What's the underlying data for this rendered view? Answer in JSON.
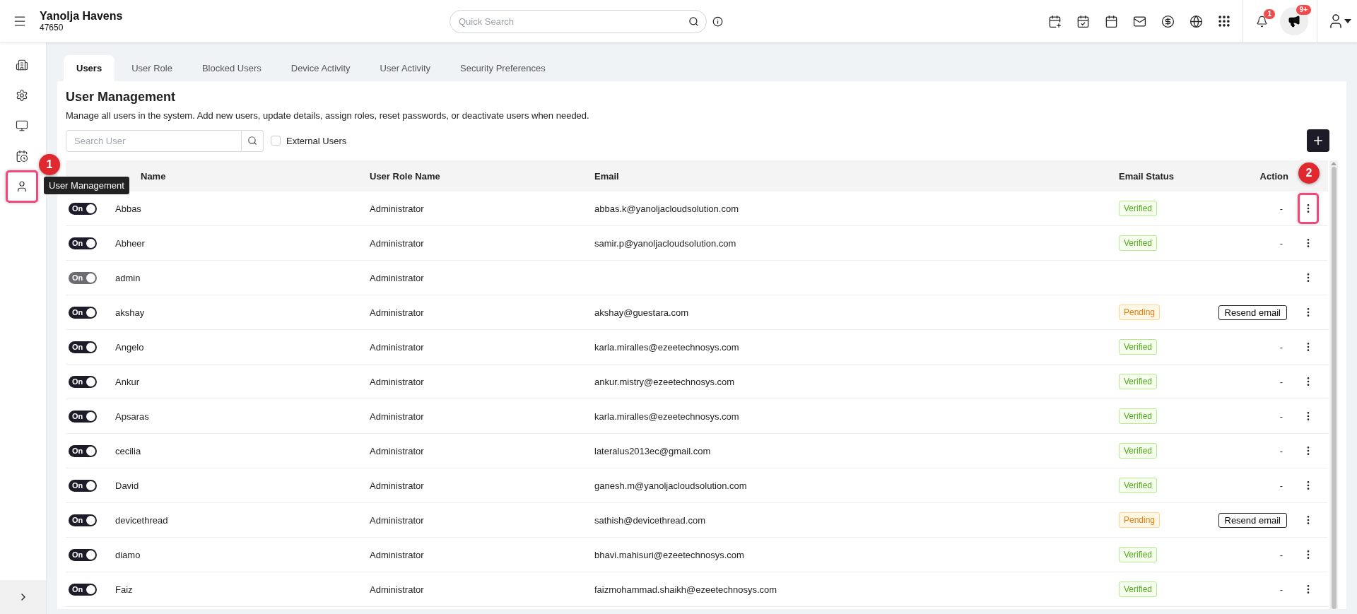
{
  "top_bar": {
    "property_name": "Yanolja Havens",
    "property_id": "47650",
    "search": {
      "placeholder": "Quick Search"
    },
    "notifications": {
      "badge": "1"
    },
    "announcements": {
      "badge": "9+"
    }
  },
  "sidebar": {
    "items": [
      {
        "kind": "building",
        "highlighted": false
      },
      {
        "kind": "settings",
        "highlighted": false
      },
      {
        "kind": "monitor",
        "highlighted": false
      },
      {
        "kind": "calendar",
        "highlighted": false
      },
      {
        "kind": "user",
        "highlighted": true,
        "marker": "1",
        "tooltip": "User Management"
      }
    ]
  },
  "tabs": [
    {
      "label": "Users",
      "selected": true
    },
    {
      "label": "User Role",
      "selected": false
    },
    {
      "label": "Blocked Users",
      "selected": false
    },
    {
      "label": "Device Activity",
      "selected": false
    },
    {
      "label": "User Activity",
      "selected": false
    },
    {
      "label": "Security Preferences",
      "selected": false
    }
  ],
  "panel": {
    "title": "User Management",
    "description": "Manage all users in the system. Add new users, update details, assign roles, reset passwords, or deactivate users when needed.",
    "search": {
      "placeholder": "Search User"
    },
    "external_users": {
      "label": "External Users",
      "checked": false
    }
  },
  "table": {
    "columns": [
      "Name",
      "User Role Name",
      "Email",
      "Email Status",
      "Action"
    ],
    "rows": [
      {
        "toggle": {
          "label": "On",
          "on": true,
          "disabled": false
        },
        "name": "Abbas",
        "role": "Administrator",
        "email": "abbas.k@yanoljacloudsolution.com",
        "status": {
          "label": "Verified",
          "kind": "verified"
        },
        "action": {
          "kind": "dash",
          "label": "-"
        },
        "menu_highlighted": true,
        "marker": "2"
      },
      {
        "toggle": {
          "label": "On",
          "on": true,
          "disabled": false
        },
        "name": "Abheer",
        "role": "Administrator",
        "email": "samir.p@yanoljacloudsolution.com",
        "status": {
          "label": "Verified",
          "kind": "verified"
        },
        "action": {
          "kind": "dash",
          "label": "-"
        },
        "menu_highlighted": false
      },
      {
        "toggle": {
          "label": "On",
          "on": true,
          "disabled": true
        },
        "name": "admin",
        "role": "Administrator",
        "menu_highlighted": false
      },
      {
        "toggle": {
          "label": "On",
          "on": true,
          "disabled": false
        },
        "name": "akshay",
        "role": "Administrator",
        "email": "akshay@guestara.com",
        "status": {
          "label": "Pending",
          "kind": "pending"
        },
        "action": {
          "kind": "button",
          "label": "Resend email"
        },
        "menu_highlighted": false
      },
      {
        "toggle": {
          "label": "On",
          "on": true,
          "disabled": false
        },
        "name": "Angelo",
        "role": "Administrator",
        "email": "karla.miralles@ezeetechnosys.com",
        "status": {
          "label": "Verified",
          "kind": "verified"
        },
        "action": {
          "kind": "dash",
          "label": "-"
        },
        "menu_highlighted": false
      },
      {
        "toggle": {
          "label": "On",
          "on": true,
          "disabled": false
        },
        "name": "Ankur",
        "role": "Administrator",
        "email": "ankur.mistry@ezeetechnosys.com",
        "status": {
          "label": "Verified",
          "kind": "verified"
        },
        "action": {
          "kind": "dash",
          "label": "-"
        },
        "menu_highlighted": false
      },
      {
        "toggle": {
          "label": "On",
          "on": true,
          "disabled": false
        },
        "name": "Apsaras",
        "role": "Administrator",
        "email": "karla.miralles@ezeetechnosys.com",
        "status": {
          "label": "Verified",
          "kind": "verified"
        },
        "action": {
          "kind": "dash",
          "label": "-"
        },
        "menu_highlighted": false
      },
      {
        "toggle": {
          "label": "On",
          "on": true,
          "disabled": false
        },
        "name": "cecilia",
        "role": "Administrator",
        "email": "lateralus2013ec@gmail.com",
        "status": {
          "label": "Verified",
          "kind": "verified"
        },
        "action": {
          "kind": "dash",
          "label": "-"
        },
        "menu_highlighted": false
      },
      {
        "toggle": {
          "label": "On",
          "on": true,
          "disabled": false
        },
        "name": "David",
        "role": "Administrator",
        "email": "ganesh.m@yanoljacloudsolution.com",
        "status": {
          "label": "Verified",
          "kind": "verified"
        },
        "action": {
          "kind": "dash",
          "label": "-"
        },
        "menu_highlighted": false
      },
      {
        "toggle": {
          "label": "On",
          "on": true,
          "disabled": false
        },
        "name": "devicethread",
        "role": "Administrator",
        "email": "sathish@devicethread.com",
        "status": {
          "label": "Pending",
          "kind": "pending"
        },
        "action": {
          "kind": "button",
          "label": "Resend email"
        },
        "menu_highlighted": false
      },
      {
        "toggle": {
          "label": "On",
          "on": true,
          "disabled": false
        },
        "name": "diamo",
        "role": "Administrator",
        "email": "bhavi.mahisuri@ezeetechnosys.com",
        "status": {
          "label": "Verified",
          "kind": "verified"
        },
        "action": {
          "kind": "dash",
          "label": "-"
        },
        "menu_highlighted": false
      },
      {
        "toggle": {
          "label": "On",
          "on": true,
          "disabled": false
        },
        "name": "Faiz",
        "role": "Administrator",
        "email": "faizmohammad.shaikh@ezeetechnosys.com",
        "status": {
          "label": "Verified",
          "kind": "verified"
        },
        "action": {
          "kind": "dash",
          "label": "-"
        },
        "menu_highlighted": false
      }
    ]
  }
}
